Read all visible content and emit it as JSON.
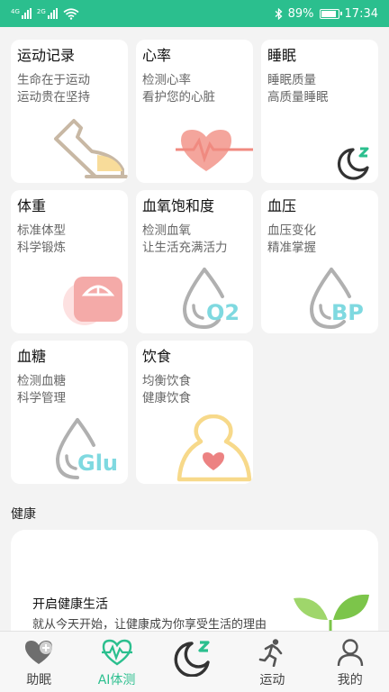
{
  "status_bar": {
    "left_indicators": [
      "4G",
      "2G"
    ],
    "battery": "89%",
    "battery_level": 0.89,
    "time": "17:34"
  },
  "cards": [
    {
      "title": "运动记录",
      "lines": [
        "生命在于运动",
        "运动贵在坚持"
      ],
      "icon": "shoe-icon"
    },
    {
      "title": "心率",
      "lines": [
        "检测心率",
        "看护您的心脏"
      ],
      "icon": "heart-rate-icon"
    },
    {
      "title": "睡眠",
      "lines": [
        "睡眠质量",
        "高质量睡眠"
      ],
      "icon": "sleep-moon-icon"
    },
    {
      "title": "体重",
      "lines": [
        "标准体型",
        "科学锻炼"
      ],
      "icon": "scale-icon"
    },
    {
      "title": "血氧饱和度",
      "lines": [
        "检测血氧",
        "让生活充满活力"
      ],
      "icon": "o2-drop-icon",
      "icon_text": "O2"
    },
    {
      "title": "血压",
      "lines": [
        "血压变化",
        "精准掌握"
      ],
      "icon": "bp-drop-icon",
      "icon_text": "BP"
    },
    {
      "title": "血糖",
      "lines": [
        "检测血糖",
        "科学管理"
      ],
      "icon": "glu-drop-icon",
      "icon_text": "Glu"
    },
    {
      "title": "饮食",
      "lines": [
        "均衡饮食",
        "健康饮食"
      ],
      "icon": "diet-icon"
    }
  ],
  "health_section": {
    "title": "健康",
    "card_title": "开启健康生活",
    "card_subtitle": "就从今天开始，让健康成为你享受生活的理由"
  },
  "nav": [
    {
      "label": "助眠",
      "icon": "sleep-aid-icon",
      "active": false
    },
    {
      "label": "AI体测",
      "icon": "ai-test-icon",
      "active": true
    },
    {
      "label": "",
      "icon": "moon-center-icon",
      "active": false
    },
    {
      "label": "运动",
      "icon": "running-icon",
      "active": false
    },
    {
      "label": "我的",
      "icon": "profile-icon",
      "active": false
    }
  ],
  "colors": {
    "accent": "#2bbf8e",
    "drop": "#b0b0b0",
    "drop_text": "#7fd9e0",
    "heart": "#f08a80",
    "diet": "#f7d98a"
  }
}
